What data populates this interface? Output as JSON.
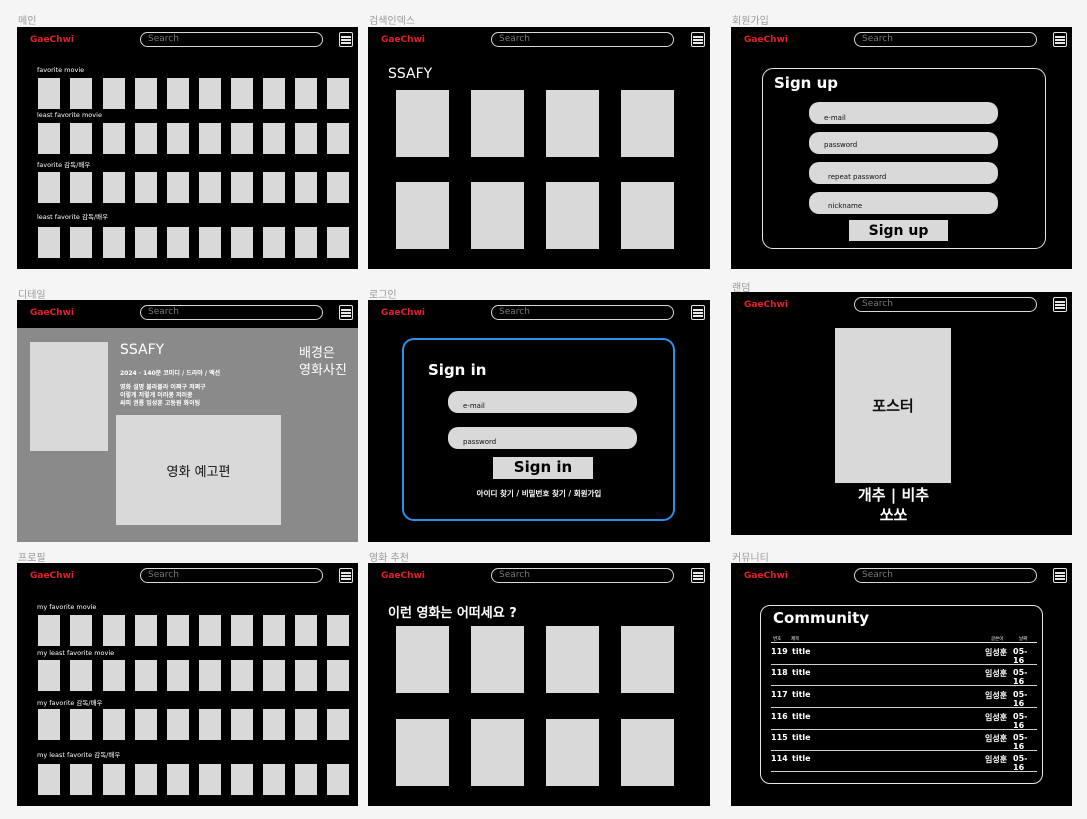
{
  "app": {
    "logo": "GaeChwi",
    "search_placeholder": "Search"
  },
  "frames": {
    "main": {
      "label": "메인",
      "rows": [
        "favorite movie",
        "least favorite movie",
        "favorite 감독/배우",
        "least favorite 감독/배우"
      ]
    },
    "search_index": {
      "label": "검색인덱스",
      "query": "SSAFY"
    },
    "signup": {
      "label": "회원가입",
      "title": "Sign up",
      "fields": [
        "e-mail",
        "password",
        "repeat password",
        "nickname"
      ],
      "button": "Sign up"
    },
    "detail": {
      "label": "디테일",
      "title": "SSAFY",
      "meta": "2024 · 140분 코미디 / 드라마 / 액션",
      "desc": [
        "영화 설명 블라블라 이쩌구 저쩌구",
        "이렇게 저렇게 이러쿵 저러쿵",
        "싸피 권룡 임성훈 고동원 화이팅"
      ],
      "bg_note": [
        "배경은",
        "영화사진"
      ],
      "trailer": "영화 예고편"
    },
    "login": {
      "label": "로그인",
      "title": "Sign in",
      "fields": [
        "e-mail",
        "password"
      ],
      "button": "Sign in",
      "links": "아이디 찾기 / 비밀번호 찾기 / 회원가입"
    },
    "random": {
      "label": "랜덤",
      "poster": "포스터",
      "vote_line1": "개추 | 비추",
      "vote_line2": "쏘쏘"
    },
    "profile": {
      "label": "프로필",
      "rows": [
        "my favorite movie",
        "my least favorite movie",
        "my favorite 감독/배우",
        "my least favorite 감독/배우"
      ]
    },
    "recommend": {
      "label": "영화 추천",
      "heading": "이런 영화는 어떠세요 ?"
    },
    "community": {
      "label": "커뮤니티",
      "title": "Community",
      "headers": {
        "no": "번호",
        "title": "제목",
        "author": "글쓴이",
        "date": "날짜"
      },
      "posts": [
        {
          "no": "119",
          "title": "title",
          "author": "임성훈",
          "date": "05-16"
        },
        {
          "no": "118",
          "title": "title",
          "author": "임성훈",
          "date": "05-16"
        },
        {
          "no": "117",
          "title": "title",
          "author": "임성훈",
          "date": "05-16"
        },
        {
          "no": "116",
          "title": "title",
          "author": "임성훈",
          "date": "05-16"
        },
        {
          "no": "115",
          "title": "title",
          "author": "임성훈",
          "date": "05-16"
        },
        {
          "no": "114",
          "title": "title",
          "author": "임성훈",
          "date": "05-16"
        }
      ]
    }
  },
  "colors": {
    "logo": "#e0202a",
    "frame_bg": "#000000",
    "placeholder": "#d9d9d9",
    "detail_bg": "#8a8a8a",
    "signin_border": "#2e8fe6"
  }
}
